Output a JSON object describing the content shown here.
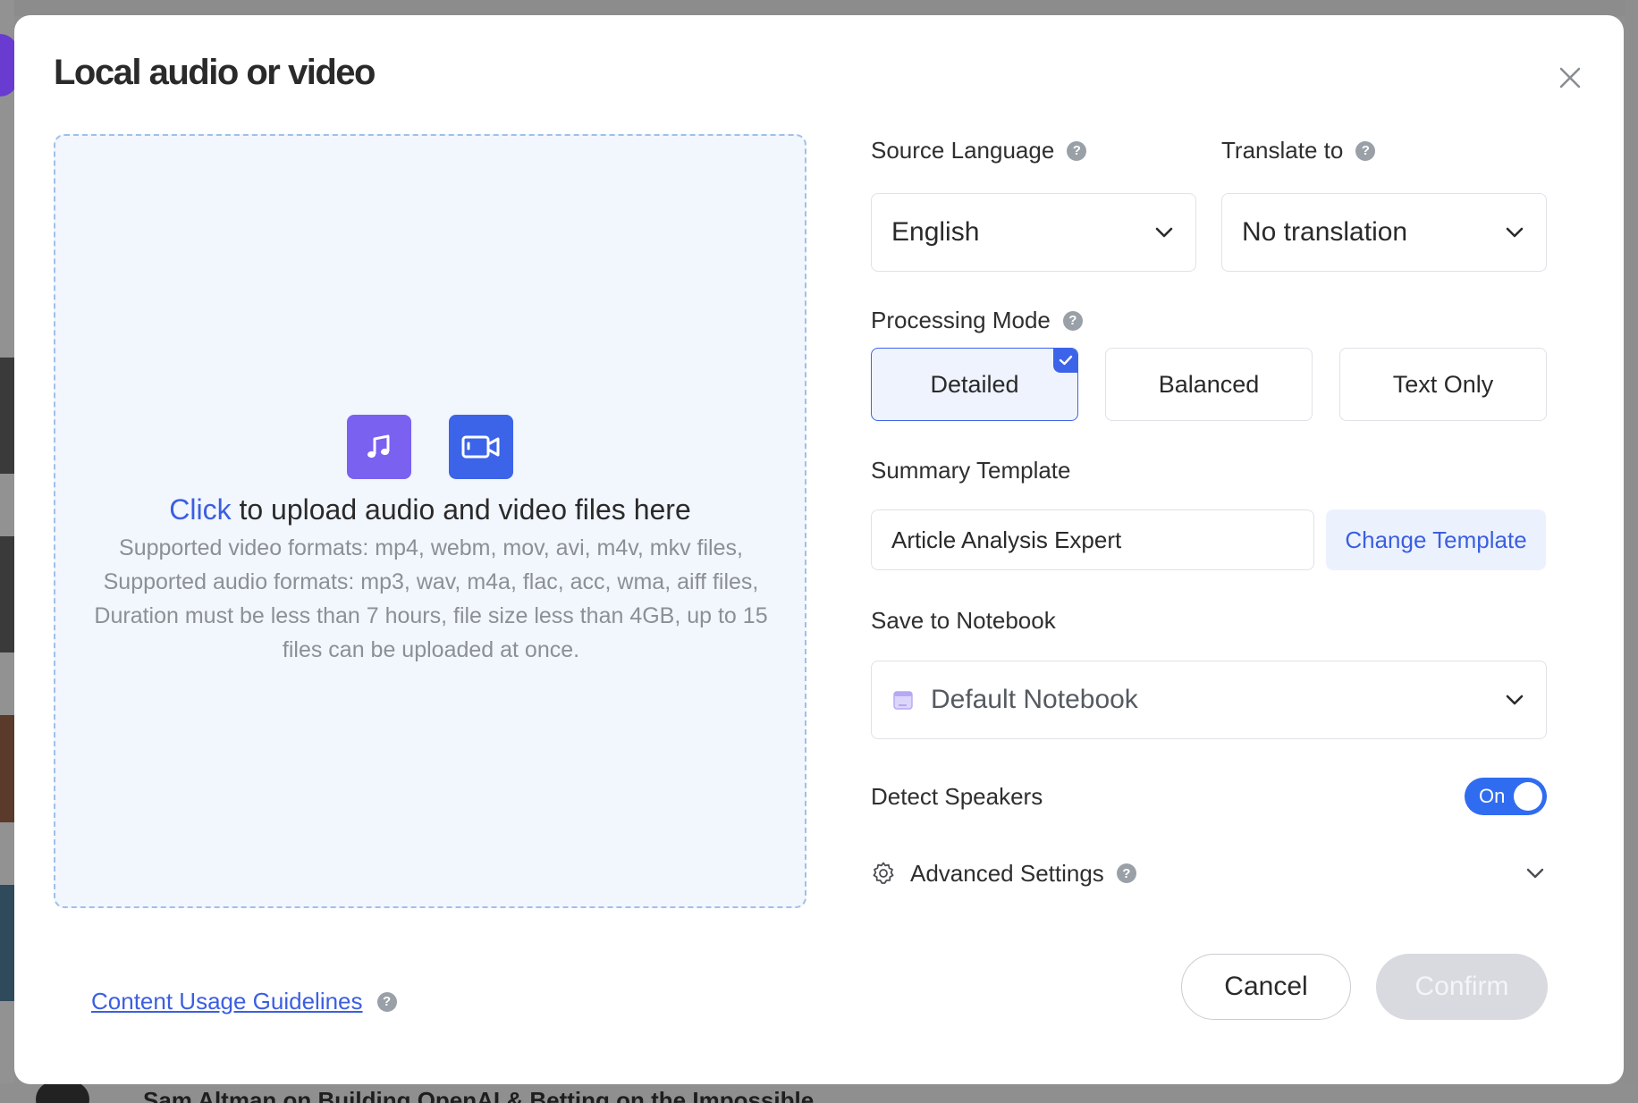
{
  "dialog": {
    "title": "Local audio or video"
  },
  "upload": {
    "click_label": "Click",
    "headline_rest": " to upload audio and video files here",
    "description": "Supported video formats: mp4, webm, mov, avi, m4v, mkv files, Supported audio formats: mp3, wav, m4a, flac, acc, wma, aiff files, Duration must be less than 7 hours, file size less than 4GB, up to 15 files can be uploaded at once.",
    "icons": [
      "music-note-icon",
      "video-camera-icon"
    ]
  },
  "source_language": {
    "label": "Source Language",
    "value": "English"
  },
  "translate_to": {
    "label": "Translate to",
    "value": "No translation"
  },
  "processing_mode": {
    "label": "Processing Mode",
    "options": [
      "Detailed",
      "Balanced",
      "Text Only"
    ],
    "selected": "Detailed"
  },
  "summary_template": {
    "label": "Summary Template",
    "value": "Article Analysis Expert",
    "change_label": "Change Template"
  },
  "notebook": {
    "label": "Save to Notebook",
    "value": "Default Notebook"
  },
  "detect_speakers": {
    "label": "Detect Speakers",
    "state_label": "On",
    "enabled": true
  },
  "advanced": {
    "label": "Advanced Settings"
  },
  "footer": {
    "guidelines_label": "Content Usage Guidelines",
    "cancel_label": "Cancel",
    "confirm_label": "Confirm"
  },
  "background": {
    "bottom_text": "Sam Altman on Building OpenAI & Betting on the Impossible"
  },
  "colors": {
    "accent": "#3c64e8",
    "link": "#3b5fe0",
    "audio_icon_bg": "#7b61f0",
    "toggle_on": "#2f6cf0",
    "confirm_disabled": "#d8dadf"
  }
}
